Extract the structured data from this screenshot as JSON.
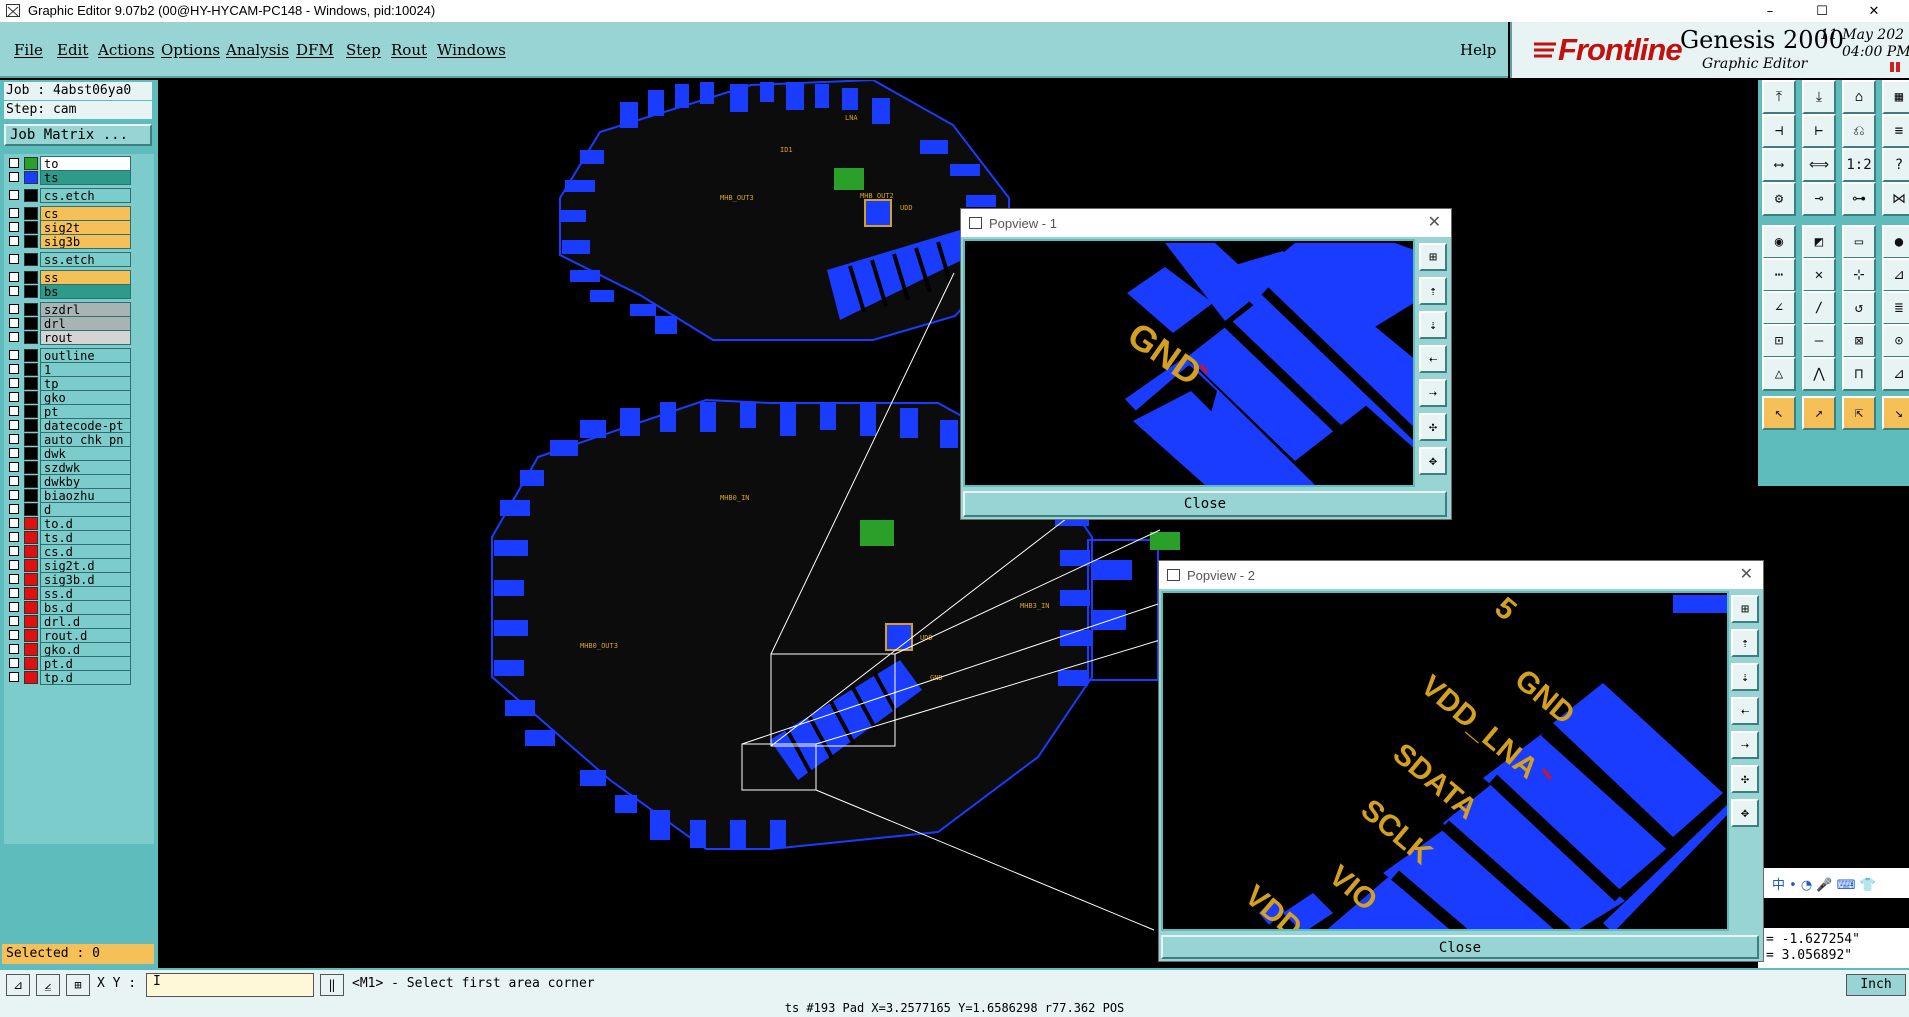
{
  "window": {
    "title": "Graphic Editor 9.07b2 (00@HY-HYCAM-PC148 - Windows, pid:10024)",
    "minimize": "–",
    "maximize": "☐",
    "close": "✕"
  },
  "menu": {
    "items": [
      "File",
      "Edit",
      "Actions",
      "Options",
      "Analysis",
      "DFM",
      "Step",
      "Rout",
      "Windows"
    ],
    "help": "Help"
  },
  "brand": {
    "logo": "Frontline",
    "product": "Genesis 2000",
    "subtitle": "Graphic Editor",
    "date": "11 May 202",
    "time": "04:00 PM"
  },
  "left_panel": {
    "job": "Job : 4abst06ya0",
    "step": "Step: cam",
    "job_matrix_button": "Job Matrix ...",
    "layers": [
      {
        "name": "to",
        "color": "#2aa02a",
        "bg": "#ffffff"
      },
      {
        "name": "ts",
        "color": "#1a3cff",
        "bg": "#2e9a8a"
      },
      {
        "name": "cs.etch",
        "color": "#000000",
        "bg": "#7ccccc"
      },
      {
        "name": "cs",
        "color": "#000000",
        "bg": "#f5c058"
      },
      {
        "name": "sig2t",
        "color": "#000000",
        "bg": "#f5c058"
      },
      {
        "name": "sig3b",
        "color": "#000000",
        "bg": "#f5c058"
      },
      {
        "name": "ss.etch",
        "color": "#000000",
        "bg": "#7ccccc"
      },
      {
        "name": "ss",
        "color": "#000000",
        "bg": "#f5c058"
      },
      {
        "name": "bs",
        "color": "#000000",
        "bg": "#2e9a8a"
      },
      {
        "name": "szdrl",
        "color": "#000000",
        "bg": "#a8b4b4"
      },
      {
        "name": "drl",
        "color": "#000000",
        "bg": "#a8b4b4"
      },
      {
        "name": "rout",
        "color": "#000000",
        "bg": "#d4d4d4"
      },
      {
        "name": "outline",
        "color": "#000000",
        "bg": "#7ccccc"
      },
      {
        "name": "1",
        "color": "#000000",
        "bg": "#7ccccc"
      },
      {
        "name": "tp",
        "color": "#000000",
        "bg": "#7ccccc"
      },
      {
        "name": "gko",
        "color": "#000000",
        "bg": "#7ccccc"
      },
      {
        "name": "pt",
        "color": "#000000",
        "bg": "#7ccccc"
      },
      {
        "name": "datecode-pt",
        "color": "#000000",
        "bg": "#7ccccc"
      },
      {
        "name": "auto_chk_pn",
        "color": "#000000",
        "bg": "#7ccccc"
      },
      {
        "name": "dwk",
        "color": "#000000",
        "bg": "#7ccccc"
      },
      {
        "name": "szdwk",
        "color": "#000000",
        "bg": "#7ccccc"
      },
      {
        "name": "dwkby",
        "color": "#000000",
        "bg": "#7ccccc"
      },
      {
        "name": "biaozhu",
        "color": "#000000",
        "bg": "#7ccccc"
      },
      {
        "name": "d",
        "color": "#000000",
        "bg": "#7ccccc"
      },
      {
        "name": "to.d",
        "color": "#e01010",
        "bg": "#7ccccc"
      },
      {
        "name": "ts.d",
        "color": "#e01010",
        "bg": "#7ccccc"
      },
      {
        "name": "cs.d",
        "color": "#e01010",
        "bg": "#7ccccc"
      },
      {
        "name": "sig2t.d",
        "color": "#e01010",
        "bg": "#7ccccc"
      },
      {
        "name": "sig3b.d",
        "color": "#e01010",
        "bg": "#7ccccc"
      },
      {
        "name": "ss.d",
        "color": "#e01010",
        "bg": "#7ccccc"
      },
      {
        "name": "bs.d",
        "color": "#e01010",
        "bg": "#7ccccc"
      },
      {
        "name": "drl.d",
        "color": "#e01010",
        "bg": "#7ccccc"
      },
      {
        "name": "rout.d",
        "color": "#e01010",
        "bg": "#7ccccc"
      },
      {
        "name": "gko.d",
        "color": "#e01010",
        "bg": "#7ccccc"
      },
      {
        "name": "pt.d",
        "color": "#e01010",
        "bg": "#7ccccc"
      },
      {
        "name": "tp.d",
        "color": "#e01010",
        "bg": "#7ccccc"
      }
    ],
    "selected": "Selected : 0"
  },
  "popview1": {
    "title": "Popview - 1",
    "close": "Close",
    "labels": [
      "GND"
    ]
  },
  "popview2": {
    "title": "Popview - 2",
    "close": "Close",
    "labels": [
      "GND",
      "VDD_LNA",
      "SDATA",
      "SCLK",
      "VIO",
      "VDD",
      "5"
    ]
  },
  "coords": {
    "x": "= -1.627254\"",
    "y": "= 3.056892\""
  },
  "command_bar": {
    "xy_label": "X Y :",
    "xy_value": "I",
    "prompt": "<M1> - Select first area corner",
    "units": "Inch"
  },
  "status": "ts #193 Pad X=3.2577165 Y=1.6586298 r77.362 POS",
  "colors": {
    "copper": "#1a3cff",
    "silk": "#d4a020",
    "background": "#000000",
    "panel": "#98d4d4"
  },
  "icons": {
    "ime": "sogou-ime-icon",
    "mic": "microphone-icon"
  }
}
